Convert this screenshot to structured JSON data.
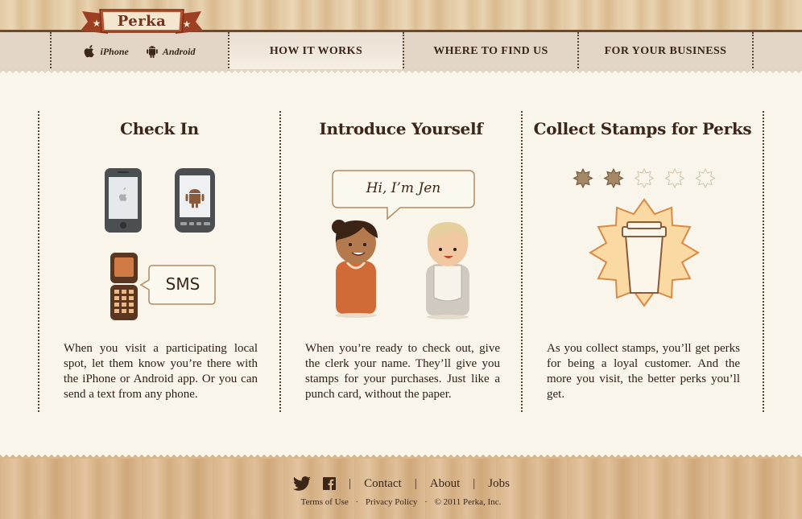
{
  "logo": {
    "text": "Perka"
  },
  "nav": {
    "apps": [
      {
        "label": "iPhone",
        "icon": "apple-icon"
      },
      {
        "label": "Android",
        "icon": "android-icon"
      }
    ],
    "items": [
      {
        "label": "HOW IT WORKS",
        "active": true
      },
      {
        "label": "WHERE TO FIND US",
        "active": false
      },
      {
        "label": "FOR YOUR BUSINESS",
        "active": false
      }
    ]
  },
  "steps": [
    {
      "title": "Check In",
      "body": "When you visit a participating local spot, let them know you’re there with the iPhone or Android app. Or you can send a text from any phone.",
      "sms_label": "SMS"
    },
    {
      "title": "Introduce Yourself",
      "body": "When you’re ready to check out, give the clerk your name. They’ll give you stamps for your purchases. Just like a punch card, without the paper.",
      "speech": "Hi, I’m Jen"
    },
    {
      "title": "Collect Stamps for Perks",
      "body": "As you collect stamps, you’ll get perks for being a loyal customer. And the more you visit, the better perks you’ll get.",
      "stamps_filled": 2,
      "stamps_total": 5
    }
  ],
  "footer": {
    "links": [
      "Contact",
      "About",
      "Jobs"
    ],
    "social": [
      "twitter-icon",
      "facebook-icon"
    ],
    "legal": [
      "Terms of Use",
      "Privacy Policy",
      "© 2011 Perka, Inc."
    ]
  },
  "colors": {
    "brand": "#b5532c",
    "text": "#3b2618",
    "background": "#f9f5ea",
    "stamp": "#f2b55c"
  }
}
